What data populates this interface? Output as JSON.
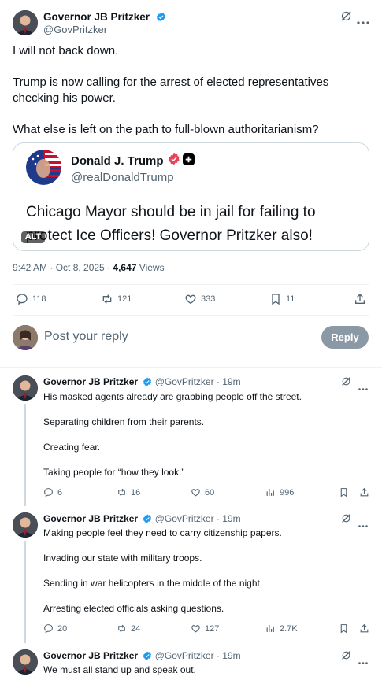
{
  "main_tweet": {
    "author_name": "Governor JB Pritzker",
    "author_handle": "@GovPritzker",
    "paragraphs": [
      "I will not back down.",
      "Trump is now calling for the arrest of elected representatives checking his power.",
      "What else is left on the path to full-blown authoritarianism?"
    ],
    "timestamp": "9:42 AM · Oct 8, 2025 ·",
    "views_count": "4,647",
    "views_label": "Views",
    "stats": {
      "replies": "118",
      "reposts": "121",
      "likes": "333",
      "bookmarks": "11"
    }
  },
  "quoted_tweet": {
    "author_name": "Donald J. Trump",
    "author_handle": "@realDonaldTrump",
    "text": "Chicago Mayor should be in jail for failing to protect Ice Officers! Governor Pritzker also!",
    "alt_badge": "ALT"
  },
  "compose": {
    "placeholder": "Post your reply",
    "reply_button": "Reply"
  },
  "replies": [
    {
      "author_name": "Governor JB Pritzker",
      "author_handle": "@GovPritzker",
      "time": "· 19m",
      "paragraphs": [
        "His masked agents already are grabbing people off the street.",
        "Separating children from their parents.",
        "Creating fear.",
        "Taking people for “how they look.”"
      ],
      "stats": {
        "replies": "6",
        "reposts": "16",
        "likes": "60",
        "views": "996"
      }
    },
    {
      "author_name": "Governor JB Pritzker",
      "author_handle": "@GovPritzker",
      "time": "· 19m",
      "paragraphs": [
        "Making people feel they need to carry citizenship papers.",
        "Invading our state with military troops.",
        "Sending in war helicopters in the middle of the night.",
        "Arresting elected officials asking questions."
      ],
      "stats": {
        "replies": "20",
        "reposts": "24",
        "likes": "127",
        "views": "2.7K"
      }
    },
    {
      "author_name": "Governor JB Pritzker",
      "author_handle": "@GovPritzker",
      "time": "· 19m",
      "paragraphs": [
        "We must all stand up and speak out."
      ]
    }
  ],
  "colors": {
    "verified_blue": "#1d9bf0",
    "text_primary": "#0f1419",
    "text_secondary": "#536471",
    "reply_button_bg": "#8b98a5",
    "truth_badge": "#e8425a"
  }
}
